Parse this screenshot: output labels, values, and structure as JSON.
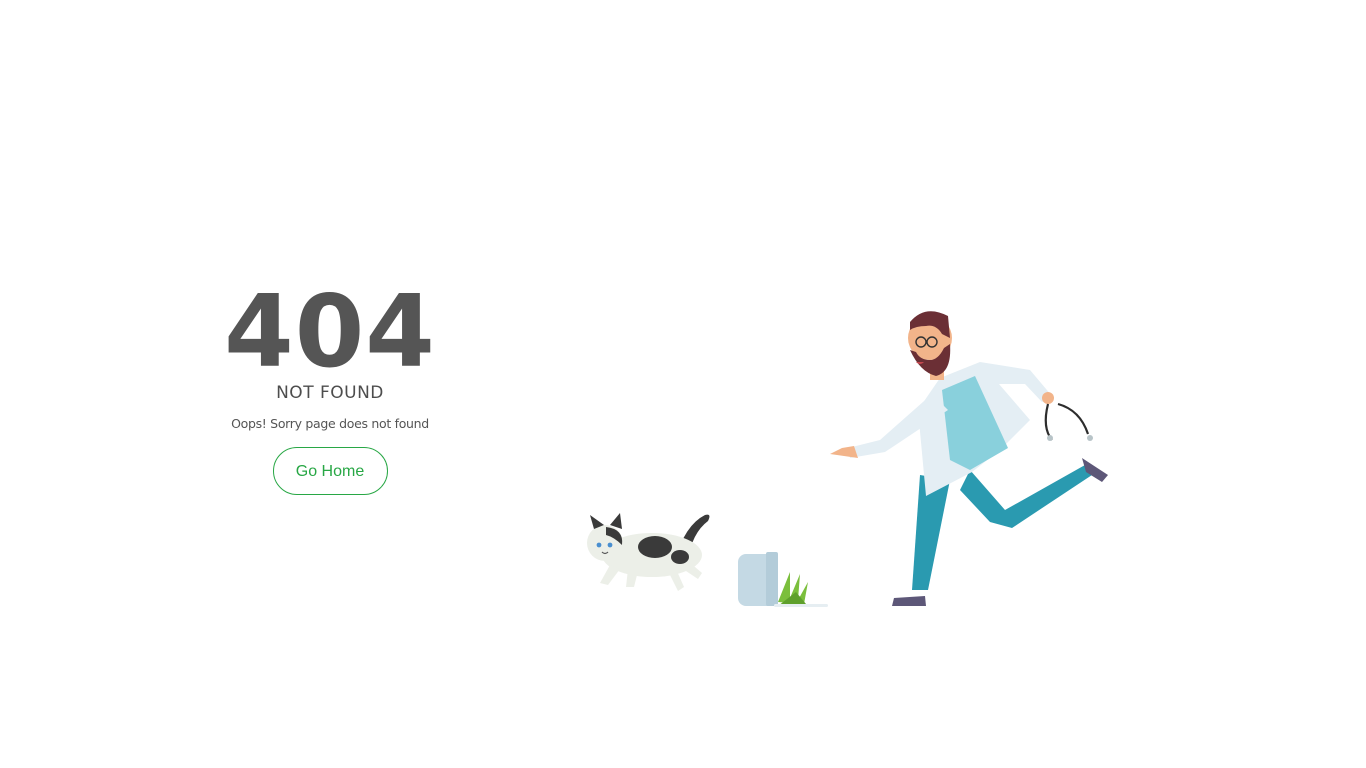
{
  "error": {
    "code": "404",
    "title": "NOT FOUND",
    "message": "Oops! Sorry page does not found"
  },
  "actions": {
    "home_label": "Go Home"
  },
  "colors": {
    "accent": "#28a745",
    "text": "#555555",
    "background": "#ffffff"
  },
  "illustration": {
    "icons": [
      "cat-icon",
      "plant-pot-icon",
      "doctor-icon",
      "stethoscope-icon"
    ]
  }
}
